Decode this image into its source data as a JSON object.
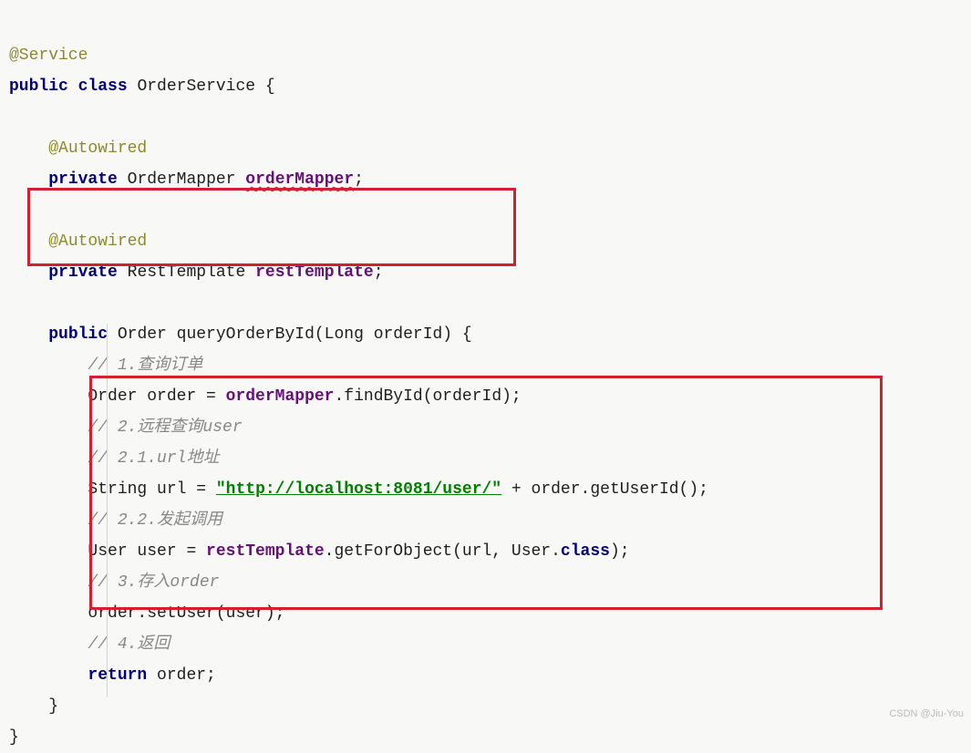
{
  "code": {
    "line1_annotation": "@Service",
    "line2_public": "public",
    "line2_class": "class",
    "line2_name": "OrderService {",
    "line4_annotation": "@Autowired",
    "line5_private": "private",
    "line5_type": "OrderMapper",
    "line5_field": "orderMapper",
    "line5_semi": ";",
    "line7_annotation": "@Autowired",
    "line8_private": "private",
    "line8_type": "RestTemplate",
    "line8_field": "restTemplate",
    "line8_semi": ";",
    "line10_public": "public",
    "line10_rest": "Order queryOrderById(Long orderId) {",
    "line11_comment": "// 1.查询订单",
    "line12_pre": "Order order = ",
    "line12_field": "orderMapper",
    "line12_post": ".findById(orderId);",
    "line13_comment": "// 2.远程查询user",
    "line14_comment": "// 2.1.url地址",
    "line15_pre": "String url = ",
    "line15_str": "\"http://localhost:8081/user/\"",
    "line15_post": " + order.getUserId();",
    "line16_comment": "// 2.2.发起调用",
    "line17_pre": "User user = ",
    "line17_field": "restTemplate",
    "line17_mid": ".getForObject(url, User.",
    "line17_class": "class",
    "line17_post": ");",
    "line18_comment": "// 3.存入order",
    "line19": "order.setUser(user);",
    "line20_comment": "// 4.返回",
    "line21_return": "return",
    "line21_post": " order;",
    "line22": "}",
    "line23": "}"
  },
  "watermark": "CSDN @Jiu-You"
}
